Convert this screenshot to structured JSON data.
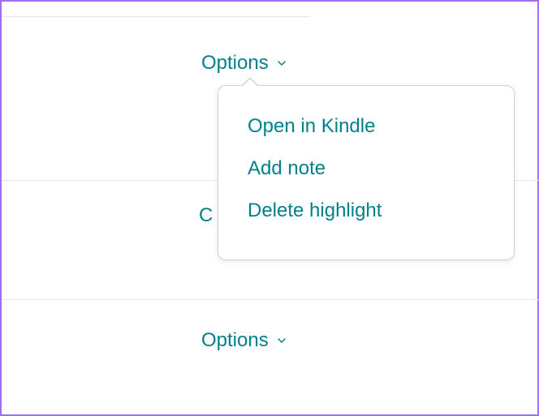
{
  "options_triggers": {
    "top": {
      "label": "Options"
    },
    "bottom": {
      "label": "Options"
    }
  },
  "menu": {
    "items": [
      {
        "label": "Open in Kindle"
      },
      {
        "label": "Add note"
      },
      {
        "label": "Delete highlight"
      }
    ]
  },
  "colors": {
    "accent": "#00818a",
    "border_purple": "#a070f0",
    "divider": "#e6e6e6"
  }
}
